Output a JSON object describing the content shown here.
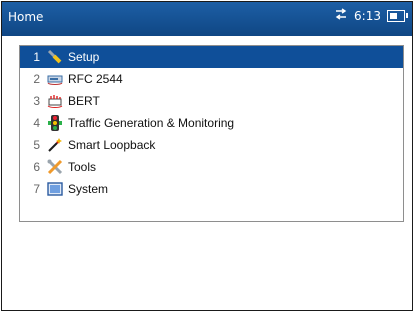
{
  "window": {
    "title": "Home"
  },
  "status": {
    "time": "6:13",
    "transfer_icon": "transfer-arrows-icon",
    "battery_icon": "battery-icon"
  },
  "menu": {
    "items": [
      {
        "index": "1",
        "label": "Setup",
        "icon": "setup-icon"
      },
      {
        "index": "2",
        "label": "RFC 2544",
        "icon": "rfc-2544-icon"
      },
      {
        "index": "3",
        "label": "BERT",
        "icon": "bert-icon"
      },
      {
        "index": "4",
        "label": "Traffic Generation  & Monitoring",
        "icon": "traffic-light-icon"
      },
      {
        "index": "5",
        "label": "Smart Loopback",
        "icon": "loopback-icon"
      },
      {
        "index": "6",
        "label": "Tools",
        "icon": "tools-icon"
      },
      {
        "index": "7",
        "label": "System",
        "icon": "system-icon"
      }
    ]
  },
  "colors": {
    "titlebar": "#0f4684",
    "selected": "#0f4f99"
  }
}
